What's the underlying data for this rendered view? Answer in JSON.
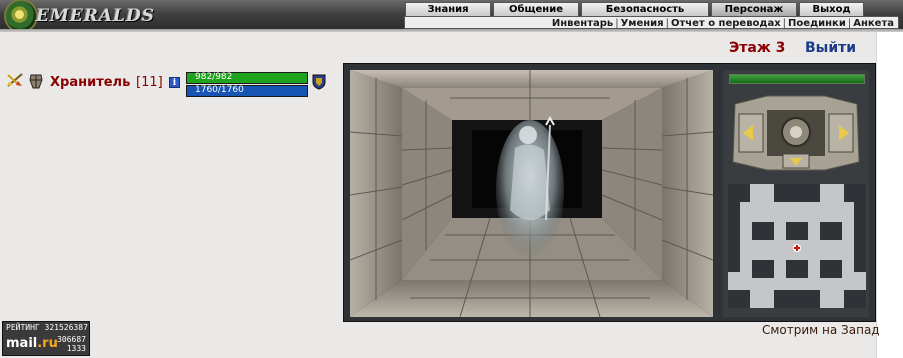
{
  "header": {
    "logo_text": "EMERALDS",
    "main_menu": [
      {
        "label": "Знания",
        "active": false
      },
      {
        "label": "Общение",
        "active": false
      },
      {
        "label": "Безопасность",
        "active": false
      },
      {
        "label": "Персонаж",
        "active": true
      },
      {
        "label": "Выход",
        "active": false
      }
    ],
    "sub_menu": [
      "Инвентарь",
      "Умения",
      "Отчет о переводах",
      "Поединки",
      "Анкета"
    ]
  },
  "location": {
    "floor_label": "Этаж 3",
    "exit_label": "Выйти",
    "facing_text": "Смотрим на Запад"
  },
  "player": {
    "name": "Хранитель",
    "level": "[11]",
    "info_icon": "i",
    "hp_text": "982/982",
    "hp_fraction": 1.0,
    "mp_text": "1760/1760",
    "mp_fraction": 1.0,
    "icons": [
      "crossed-swords-icon",
      "armor-icon",
      "info-icon",
      "shield-badge-icon"
    ]
  },
  "game": {
    "energy_fraction": 1.0,
    "view_scene": "stone-corridor-with-ghost-mage",
    "controls": [
      "turn-left-icon",
      "turn-right-icon",
      "move-back-icon",
      "center-action-icon"
    ],
    "minimap_marker": "red-cross-player-marker"
  },
  "counter": {
    "label": "РЕЙТИНГ 321526387",
    "brand_a": "mail",
    "brand_b": ".ru",
    "n1": "306687",
    "n2": "1333"
  },
  "colors": {
    "title_red": "#8b0000",
    "exit_blue": "#1a3c8a",
    "hp_green": "#1fa31f",
    "mp_blue": "#1655b4"
  }
}
